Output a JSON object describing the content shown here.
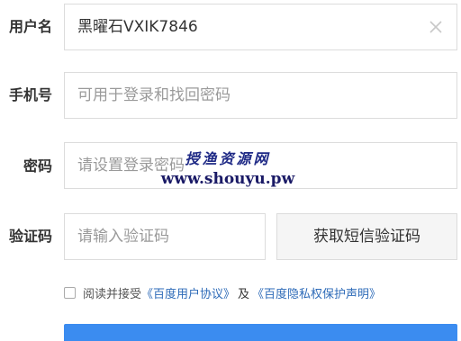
{
  "form": {
    "username": {
      "label": "用户名",
      "value": "黑曜石VXIK7846",
      "clear_icon": "close-icon"
    },
    "phone": {
      "label": "手机号",
      "placeholder": "可用于登录和找回密码"
    },
    "password": {
      "label": "密码",
      "placeholder": "请设置登录密码"
    },
    "captcha": {
      "label": "验证码",
      "placeholder": "请输入验证码",
      "button_label": "获取短信验证码"
    },
    "agreement": {
      "prefix": "阅读并接受",
      "link1": "《百度用户协议》",
      "and": "及",
      "link2": "《百度隐私权保护声明》",
      "checked": false
    },
    "submit": {
      "color": "#3b8cf0"
    }
  },
  "watermark": {
    "title": "授渔资源网",
    "url": "www.shouyu.pw"
  }
}
